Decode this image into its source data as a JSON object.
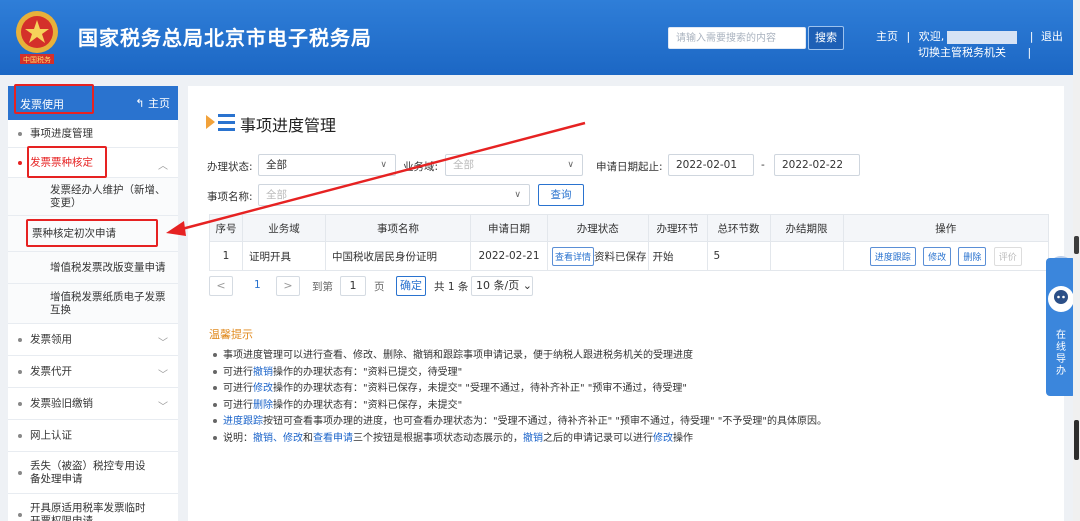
{
  "header": {
    "title": "国家税务总局北京市电子税务局",
    "emblem_caption": "中国税务",
    "search_placeholder": "请输入需要搜索的内容",
    "search_button": "搜索",
    "nav_home": "主页",
    "welcome": "欢迎,",
    "logout": "退出",
    "switch_org": "切换主管税务机关"
  },
  "sidebar": {
    "header_label": "发票使用",
    "home_link": "主页",
    "items": [
      {
        "label": "事项进度管理"
      },
      {
        "label": "发票票种核定"
      },
      {
        "label": "发票经办人维护（新增、变更）"
      },
      {
        "label": "票种核定初次申请"
      },
      {
        "label": "增值税发票改版变量申请"
      },
      {
        "label": "增值税发票纸质电子发票互换"
      },
      {
        "label": "发票领用"
      },
      {
        "label": "发票代开"
      },
      {
        "label": "发票验旧缴销"
      },
      {
        "label": "网上认证"
      },
      {
        "label": "丢失（被盗）税控专用设备处理申请"
      },
      {
        "label": "开具原适用税率发票临时开票权限申请"
      }
    ]
  },
  "main": {
    "title": "事项进度管理",
    "form": {
      "status_label": "办理状态:",
      "status_value": "全部",
      "domain_label": "业务域:",
      "domain_value": "全部",
      "date_label": "申请日期起止:",
      "date_from": "2022-02-01",
      "date_sep": "-",
      "date_to": "2022-02-22",
      "name_label": "事项名称:",
      "name_value": "全部",
      "query_button": "查询"
    },
    "table": {
      "headers": [
        "序号",
        "业务域",
        "事项名称",
        "申请日期",
        "办理状态",
        "办理环节",
        "总环节数",
        "办结期限",
        "操作"
      ],
      "rows": [
        {
          "no": "1",
          "domain": "证明开具",
          "name": "中国税收居民身份证明",
          "date": "2022-02-21",
          "detail_btn": "查看详情",
          "status": "资料已保存",
          "step": "开始",
          "total": "5",
          "deadline": ""
        }
      ],
      "actions": [
        "进度跟踪",
        "修改",
        "删除",
        "评价"
      ]
    },
    "pager": {
      "prev": "<",
      "page": "1",
      "next": ">",
      "goto_label": "到第",
      "goto_value": "1",
      "page_unit": "页",
      "confirm": "确定",
      "total": "共 1 条",
      "page_size": "10 条/页"
    },
    "tips": {
      "title": "温馨提示",
      "lines": [
        [
          "事项进度管理可以进行查看、修改、删除、撤销和跟踪事项申请记录，便于纳税人跟进税务机关的受理进度"
        ],
        [
          "可进行",
          "撤销",
          "操作的办理状态有：\"资料已提交，待受理\""
        ],
        [
          "可进行",
          "修改",
          "操作的办理状态有：\"资料已保存，未提交\"  \"受理不通过，待补齐补正\"  \"预审不通过，待受理\""
        ],
        [
          "可进行",
          "删除",
          "操作的办理状态有：\"资料已保存，未提交\""
        ],
        [
          "",
          "进度跟踪",
          "按钮可查看事项办理的进度，也可查看办理状态为：\"受理不通过，待补齐补正\"  \"预审不通过，待受理\"  \"不予受理\"的具体原因。"
        ],
        [
          "说明：",
          "撤销、修改",
          "和",
          "查看申请",
          "三个按钮是根据事项状态动态展示的，",
          "撤销",
          "之后的申请记录可以进行",
          "修改",
          "操作"
        ]
      ]
    }
  },
  "float_guide": {
    "label": "在线导办"
  },
  "colors": {
    "header_blue": "#1c67c4",
    "annotation_red": "#e62222",
    "link_blue": "#1a63c9",
    "tips_orange": "#e08a1e"
  }
}
